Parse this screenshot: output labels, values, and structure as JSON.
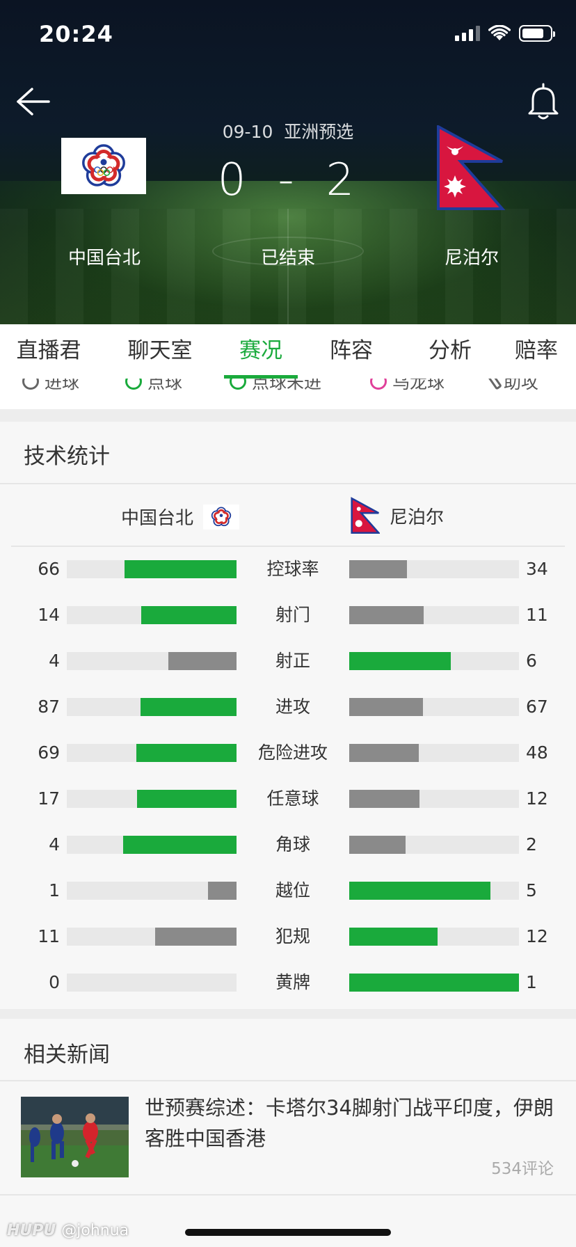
{
  "status_bar": {
    "time": "20:24"
  },
  "header": {
    "match_info": "09-10  亚洲预选",
    "home_score": "0",
    "away_score": "2",
    "score_separator": "-",
    "home_team": "中国台北",
    "away_team": "尼泊尔",
    "status": "已结束"
  },
  "tabs": [
    {
      "label": "直播君",
      "active": false
    },
    {
      "label": "聊天室",
      "active": false
    },
    {
      "label": "赛况",
      "active": true
    },
    {
      "label": "阵容",
      "active": false
    },
    {
      "label": "分析",
      "active": false
    },
    {
      "label": "赔率",
      "active": false
    }
  ],
  "legend": [
    {
      "label": "进球",
      "icon": "ball-icon",
      "color": "#666666"
    },
    {
      "label": "点球",
      "icon": "penalty-icon",
      "color": "#1aaa3c"
    },
    {
      "label": "点球未进",
      "icon": "penalty-missed-icon",
      "color": "#1aaa3c"
    },
    {
      "label": "乌龙球",
      "icon": "own-goal-icon",
      "color": "#e0409a"
    },
    {
      "label": "助攻",
      "icon": "assist-icon",
      "color": "#666666"
    }
  ],
  "stats": {
    "title": "技术统计",
    "home_team": "中国台北",
    "away_team": "尼泊尔",
    "colors": {
      "leader": "#1aaa3c",
      "trailer": "#8a8a8a",
      "track": "#e8e8e8"
    },
    "rows": [
      {
        "label": "控球率",
        "home": 66,
        "away": 34
      },
      {
        "label": "射门",
        "home": 14,
        "away": 11
      },
      {
        "label": "射正",
        "home": 4,
        "away": 6
      },
      {
        "label": "进攻",
        "home": 87,
        "away": 67
      },
      {
        "label": "危险进攻",
        "home": 69,
        "away": 48
      },
      {
        "label": "任意球",
        "home": 17,
        "away": 12
      },
      {
        "label": "角球",
        "home": 4,
        "away": 2
      },
      {
        "label": "越位",
        "home": 1,
        "away": 5
      },
      {
        "label": "犯规",
        "home": 11,
        "away": 12
      },
      {
        "label": "黄牌",
        "home": 0,
        "away": 1
      }
    ]
  },
  "news": {
    "title": "相关新闻",
    "items": [
      {
        "title": "世预赛综述：卡塔尔34脚射门战平印度，伊朗客胜中国香港",
        "comments": "534评论"
      }
    ]
  },
  "watermark": {
    "brand": "HUPU",
    "user": "@johnua"
  }
}
